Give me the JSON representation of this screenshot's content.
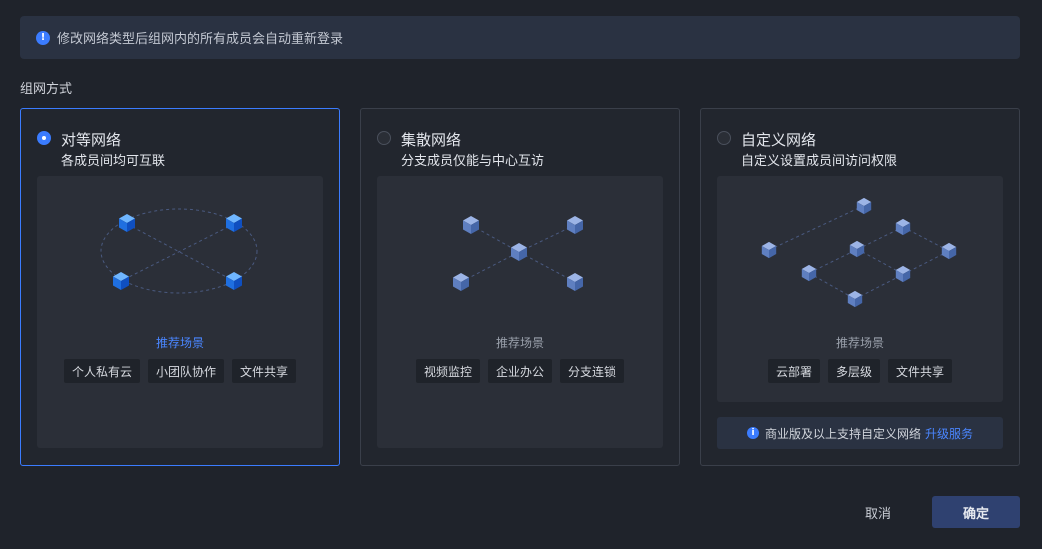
{
  "notice": {
    "icon": "exclamation-icon",
    "text": "修改网络类型后组网内的所有成员会自动重新登录"
  },
  "section_label": "组网方式",
  "cards": [
    {
      "title": "对等网络",
      "subtitle": "各成员间均可互联",
      "selected": true,
      "recommend_label": "推荐场景",
      "tags": [
        "个人私有云",
        "小团队协作",
        "文件共享"
      ]
    },
    {
      "title": "集散网络",
      "subtitle": "分支成员仅能与中心互访",
      "selected": false,
      "recommend_label": "推荐场景",
      "tags": [
        "视频监控",
        "企业办公",
        "分支连锁"
      ]
    },
    {
      "title": "自定义网络",
      "subtitle": "自定义设置成员间访问权限",
      "selected": false,
      "recommend_label": "推荐场景",
      "tags": [
        "云部署",
        "多层级",
        "文件共享"
      ]
    }
  ],
  "upgrade": {
    "icon": "info-icon",
    "text": "商业版及以上支持自定义网络",
    "link": "升级服务"
  },
  "buttons": {
    "cancel": "取消",
    "ok": "确定"
  },
  "colors": {
    "accent": "#3b7cff",
    "background": "#1f232b",
    "ok_button": "#2f4170"
  }
}
